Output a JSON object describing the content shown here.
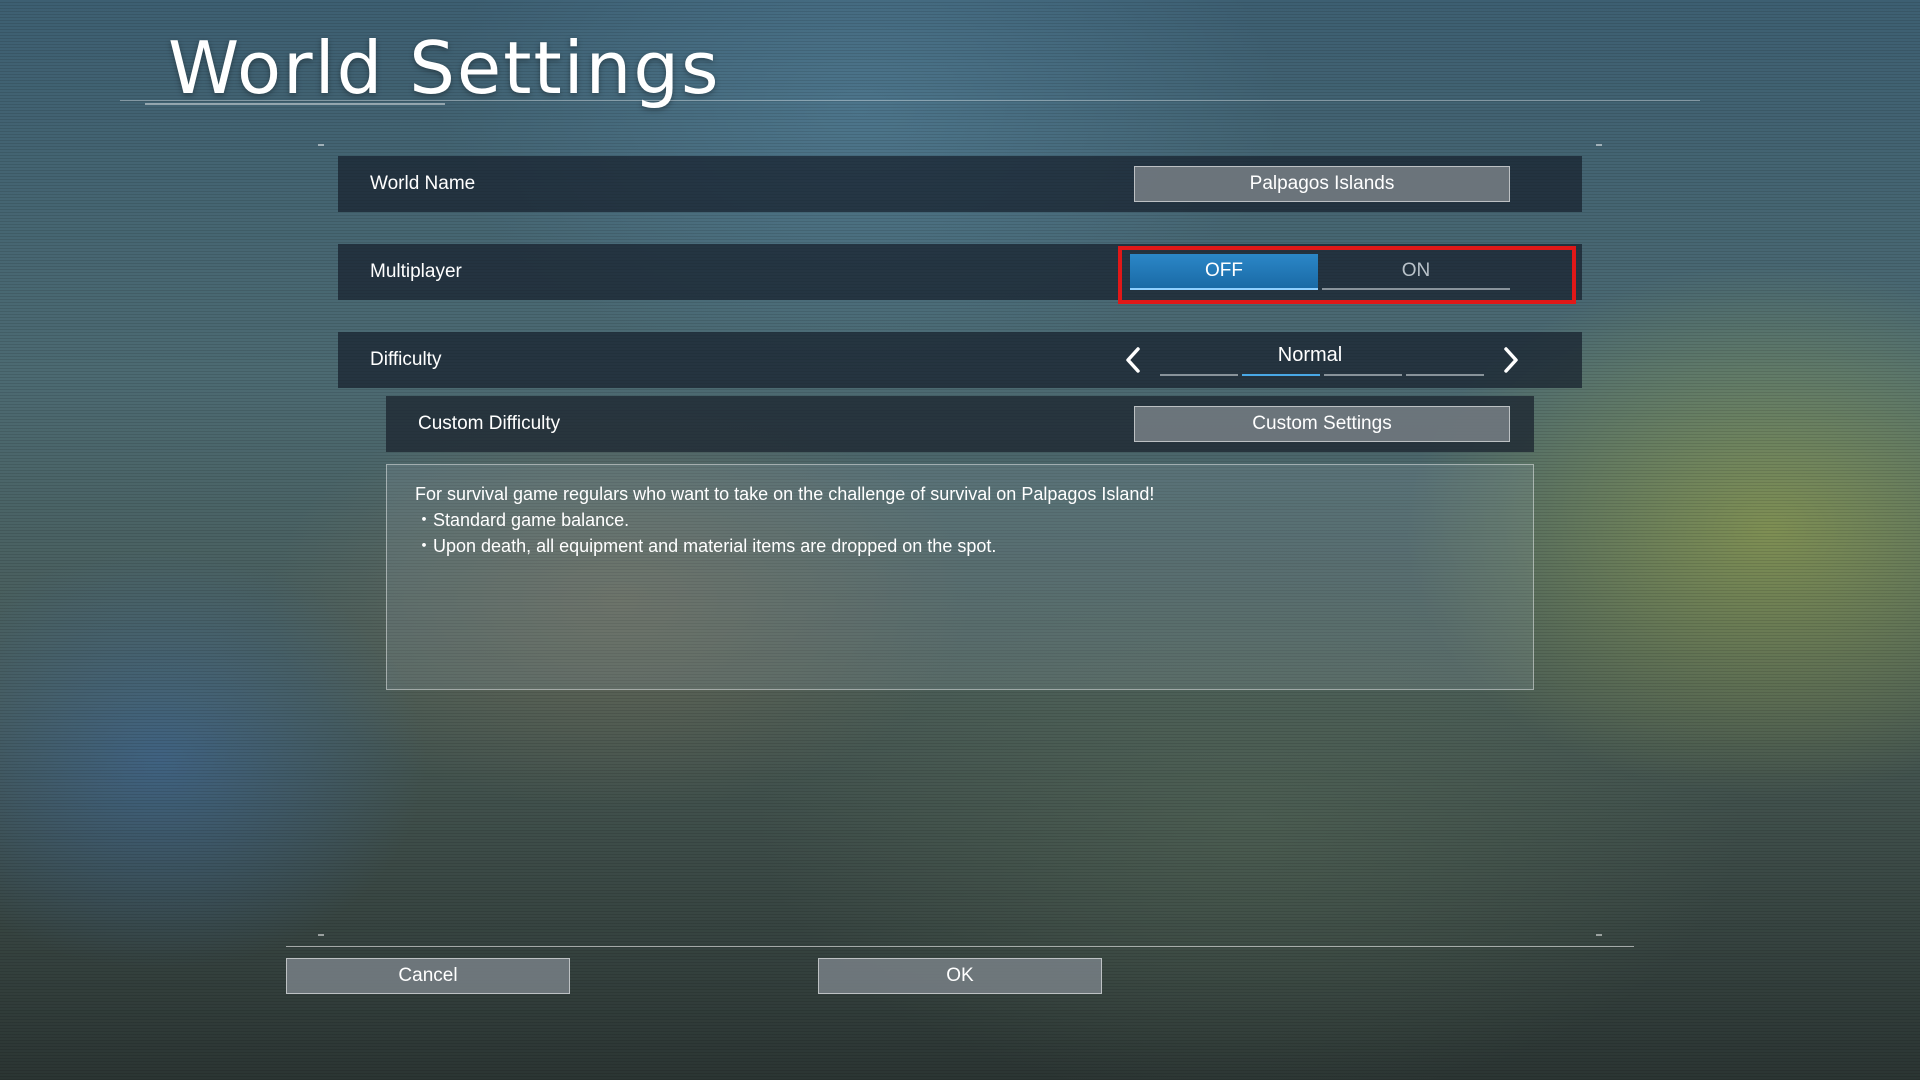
{
  "header": {
    "title": "World Settings"
  },
  "settings": {
    "world_name": {
      "label": "World Name",
      "value": "Palpagos Islands"
    },
    "multiplayer": {
      "label": "Multiplayer",
      "off_label": "OFF",
      "on_label": "ON",
      "selected": "OFF"
    },
    "difficulty": {
      "label": "Difficulty",
      "value": "Normal",
      "selected_index": 1,
      "segments": 4
    },
    "custom_difficulty": {
      "label": "Custom Difficulty",
      "button_label": "Custom Settings"
    }
  },
  "description": {
    "lines": [
      "For survival game regulars who want to take on the challenge of survival on Palpagos Island!",
      "・Standard game balance.",
      "・Upon death, all equipment and material items are dropped on the spot."
    ]
  },
  "footer": {
    "cancel_label": "Cancel",
    "ok_label": "OK"
  },
  "colors": {
    "accent": "#1a6aa6",
    "highlight": "#e01818"
  },
  "icons": {
    "prev": "chevron-left-icon",
    "next": "chevron-right-icon"
  }
}
